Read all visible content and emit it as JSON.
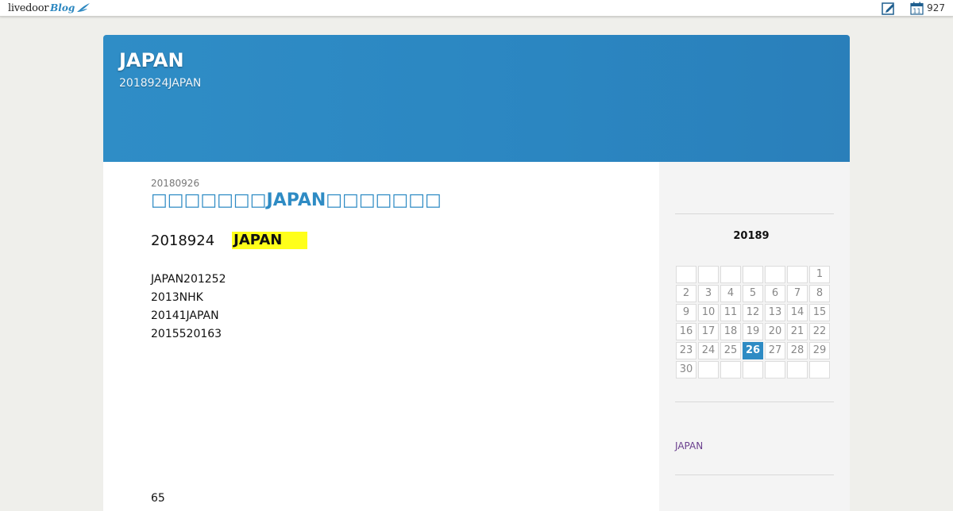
{
  "topbar": {
    "logo_text": "livedoor",
    "logo_sub": "Blog",
    "edit_icon": "edit-icon",
    "calendar_icon": "calendar-icon",
    "calendar_icon_day": "11",
    "count": "927"
  },
  "header": {
    "title": "JAPAN",
    "description": "2018924JAPAN",
    "bg_color": "#2e8bc4"
  },
  "post": {
    "date": "20180926",
    "title": "□□□□□□□JAPAN□□□□□□□",
    "lead_text": "2018924",
    "highlight": "JAPAN",
    "lines": [
      "JAPAN201252",
      "2013NHK",
      "20141JAPAN",
      "2015520163"
    ],
    "footer": "65"
  },
  "calendar": {
    "title": "20189",
    "today": "26",
    "rows": [
      [
        "",
        "",
        "",
        "",
        "",
        "",
        "1"
      ],
      [
        "2",
        "3",
        "4",
        "5",
        "6",
        "7",
        "8"
      ],
      [
        "9",
        "10",
        "11",
        "12",
        "13",
        "14",
        "15"
      ],
      [
        "16",
        "17",
        "18",
        "19",
        "20",
        "21",
        "22"
      ],
      [
        "23",
        "24",
        "25",
        "26",
        "27",
        "28",
        "29"
      ],
      [
        "30",
        "",
        "",
        "",
        "",
        "",
        ""
      ]
    ]
  },
  "sidebar": {
    "category_link": "JAPAN"
  }
}
